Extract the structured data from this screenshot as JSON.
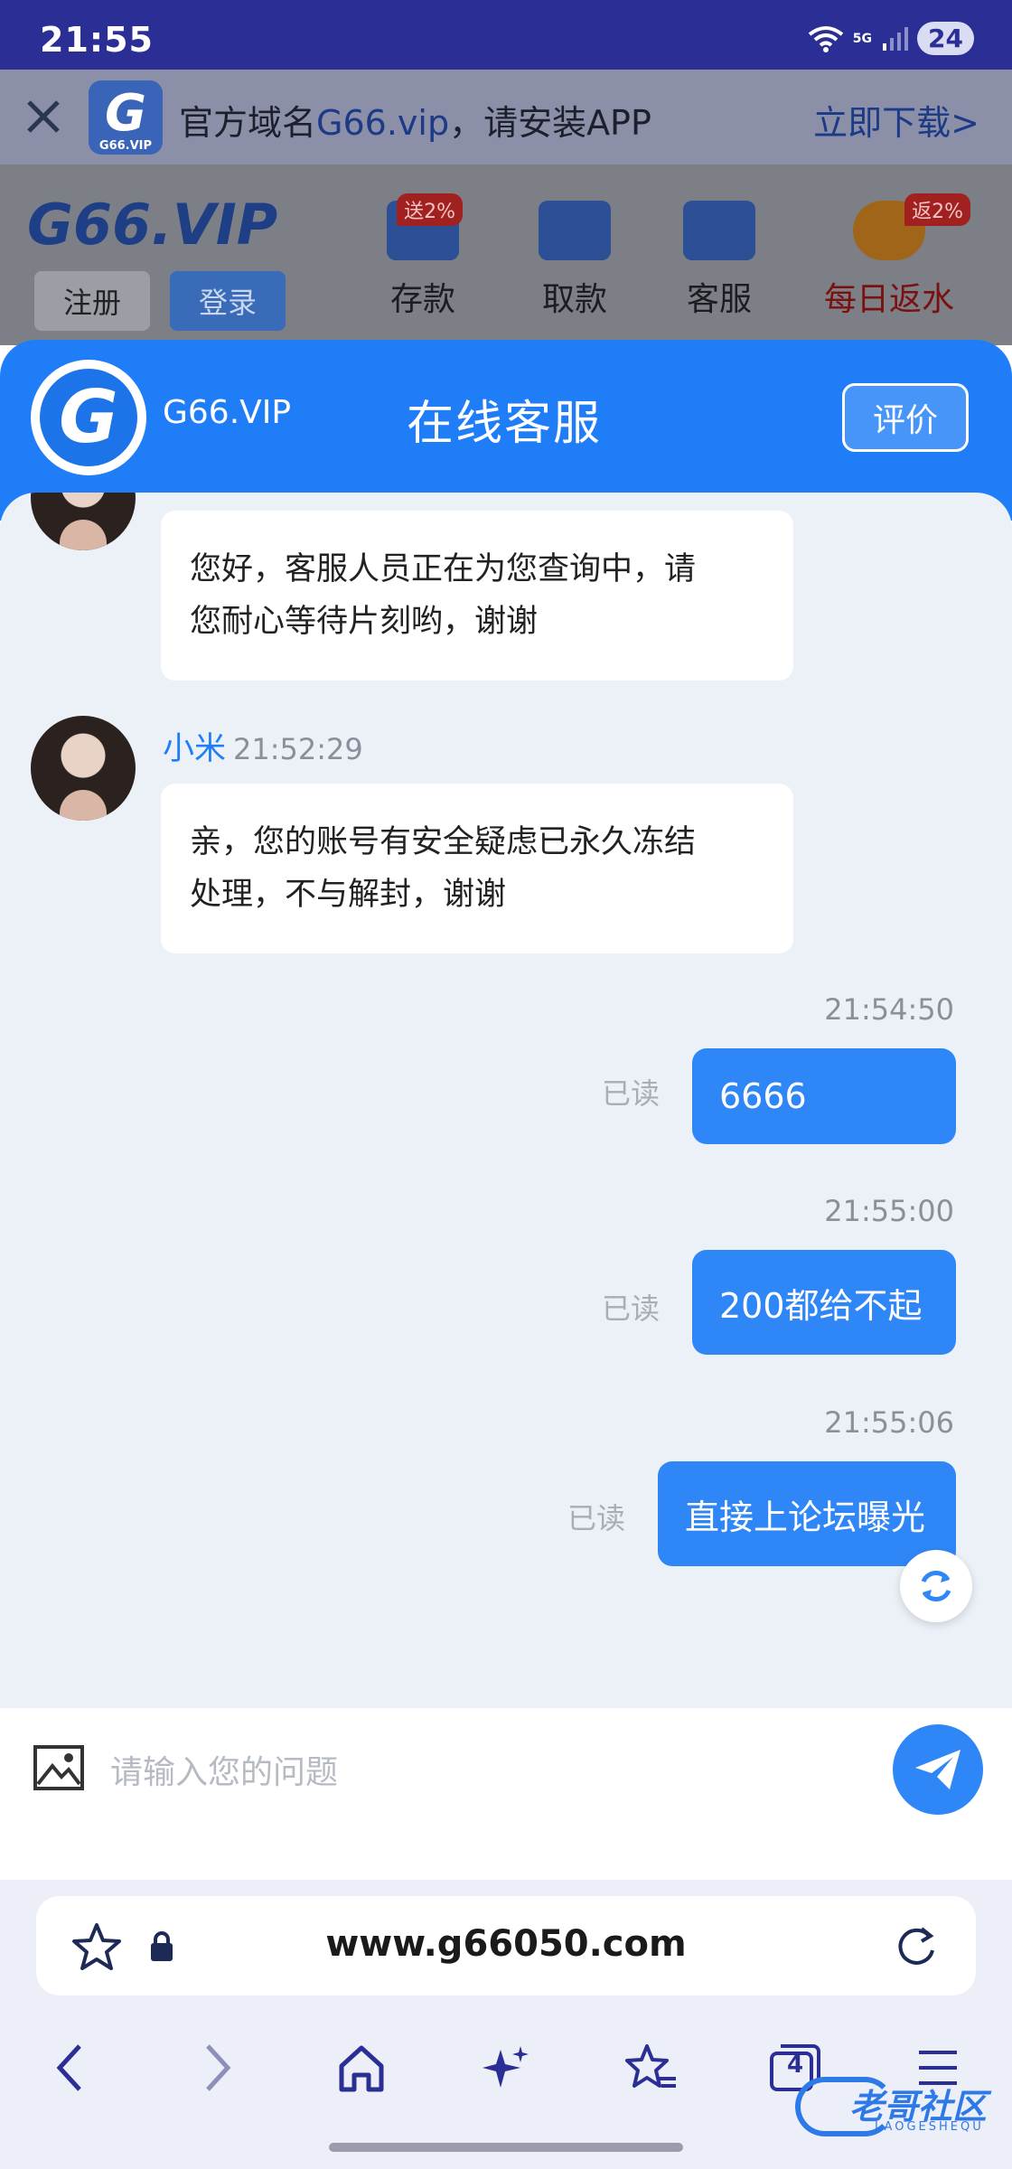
{
  "status_bar": {
    "time": "21:55",
    "network": "5G",
    "battery": "24"
  },
  "banner": {
    "logo_text": "G",
    "logo_caption": "G66.VIP",
    "message_prefix": "官方域名",
    "message_domain": "G66.vip",
    "message_suffix": "，请安装APP",
    "download_label": "立即下载>"
  },
  "background_page": {
    "brand": "G66.VIP",
    "register_label": "注册",
    "login_label": "登录",
    "actions": [
      {
        "label": "存款",
        "tag": "送2%"
      },
      {
        "label": "取款",
        "tag": ""
      },
      {
        "label": "客服",
        "tag": ""
      },
      {
        "label": "每日返水",
        "tag": "返2%"
      }
    ]
  },
  "chat_header": {
    "logo_text": "G",
    "site_name": "G66.VIP",
    "title": "在线客服",
    "rate_label": "评价"
  },
  "messages": {
    "m1": {
      "text_line1": "您好，客服人员正在为您查询中，请",
      "text_line2": "您耐心等待片刻哟，谢谢"
    },
    "m2": {
      "sender": "小米",
      "time": "21:52:29",
      "text_line1": "亲，您的账号有安全疑虑已永久冻结",
      "text_line2": "处理，不与解封，谢谢"
    },
    "m3": {
      "time": "21:54:50",
      "read": "已读",
      "text": "6666"
    },
    "m4": {
      "time": "21:55:00",
      "read": "已读",
      "text": "200都给不起"
    },
    "m5": {
      "time": "21:55:06",
      "read": "已读",
      "text": "直接上论坛曝光"
    }
  },
  "input": {
    "placeholder": "请输入您的问题"
  },
  "browser": {
    "url": "www.g66050.com",
    "tab_count": "4"
  },
  "watermark": {
    "text": "老哥社区",
    "subtext": "LAOGESHEQU"
  },
  "colors": {
    "accent": "#1f7ef7",
    "status_bar": "#2b2f95",
    "chat_bg": "#ecf1f8"
  }
}
